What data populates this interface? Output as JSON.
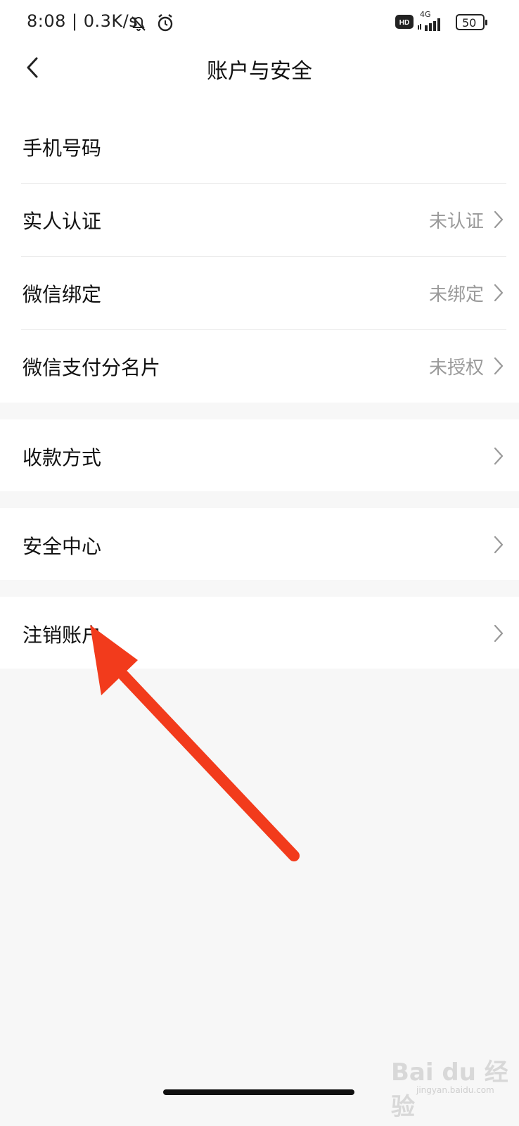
{
  "status_bar": {
    "time": "8:08 | 0.3K/s",
    "network_type": "4G",
    "battery": "50",
    "icons": [
      "mute-icon",
      "alarm-icon",
      "hd-icon",
      "signal-icon",
      "battery-icon"
    ]
  },
  "header": {
    "title": "账户与安全",
    "back_icon": "chevron-left-icon"
  },
  "rows": [
    {
      "label": "手机号码",
      "value": "",
      "chevron": false
    },
    {
      "label": "实人认证",
      "value": "未认证",
      "chevron": true
    },
    {
      "label": "微信绑定",
      "value": "未绑定",
      "chevron": true
    },
    {
      "label": "微信支付分名片",
      "value": "未授权",
      "chevron": true
    },
    {
      "label": "收款方式",
      "value": "",
      "chevron": true
    },
    {
      "label": "安全中心",
      "value": "",
      "chevron": true
    },
    {
      "label": "注销账户",
      "value": "",
      "chevron": true
    }
  ],
  "annotation": {
    "type": "arrow",
    "color": "#f23b1c",
    "points_to": "注销账户"
  },
  "watermark": {
    "text": "Bai du 经验",
    "sub": "jingyan.baidu.com"
  },
  "colors": {
    "background": "#f7f7f7",
    "surface": "#ffffff",
    "text": "#111111",
    "secondary_text": "#9a9a9a",
    "arrow": "#f23b1c"
  }
}
